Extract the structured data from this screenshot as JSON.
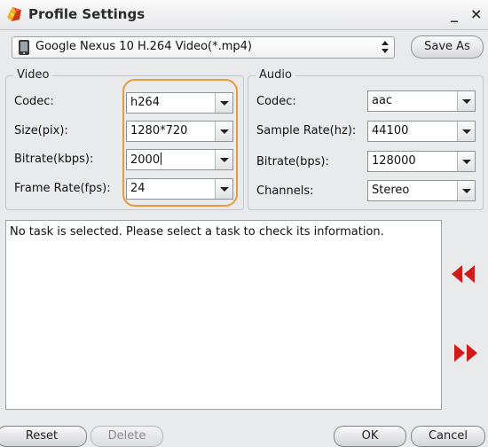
{
  "window": {
    "title": "Profile Settings",
    "minimize": "_",
    "close": "×"
  },
  "profile": {
    "selected": "Google Nexus 10 H.264 Video(*.mp4)",
    "save_as": "Save As"
  },
  "video": {
    "group_label": "Video",
    "codec": {
      "label": "Codec:",
      "value": "h264"
    },
    "size": {
      "label": "Size(pix):",
      "value": "1280*720"
    },
    "bitrate": {
      "label": "Bitrate(kbps):",
      "value": "2000"
    },
    "frame_rate": {
      "label": "Frame Rate(fps):",
      "value": "24"
    }
  },
  "audio": {
    "group_label": "Audio",
    "codec": {
      "label": "Codec:",
      "value": "aac"
    },
    "sample_rate": {
      "label": "Sample Rate(hz):",
      "value": "44100"
    },
    "bitrate": {
      "label": "Bitrate(bps):",
      "value": "128000"
    },
    "channels": {
      "label": "Channels:",
      "value": "Stereo"
    }
  },
  "info": {
    "message": "No task is selected. Please select a task to check its information."
  },
  "buttons": {
    "reset": "Reset",
    "delete": "Delete",
    "ok": "OK",
    "cancel": "Cancel"
  },
  "colors": {
    "highlight": "#e89a3c",
    "arrows": "#d11a1a",
    "background": "#e9eaec"
  },
  "icons": {
    "app": "app-logo-icon",
    "profile": "phone-device-icon",
    "prev": "rewind-arrows-icon",
    "next": "forward-arrows-icon"
  }
}
